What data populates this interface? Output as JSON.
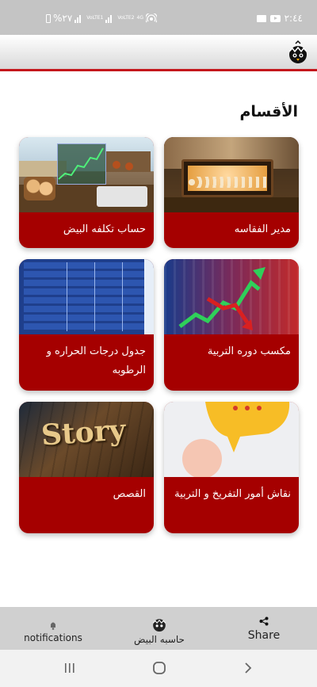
{
  "status": {
    "time": "٢:٤٤",
    "battery": "%٢٧",
    "net1": "VoLTE1",
    "net2": "VoLTE2",
    "net3": "4G"
  },
  "section_title": "الأقسام",
  "cards": [
    {
      "label": "مدير الفقاسه"
    },
    {
      "label": "حساب تكلفه البيض"
    },
    {
      "label": "مكسب دوره التربية"
    },
    {
      "label": "جدول درجات الحراره و الرطوبه"
    },
    {
      "label": "نقاش أمور التفريخ و التربية"
    },
    {
      "label": "القصص"
    }
  ],
  "story_image_text": "Story",
  "bottom_nav": {
    "notifications": "notifications",
    "calculator": "حاسبه البيض",
    "share": "Share"
  },
  "colors": {
    "card_bg": "#a50000",
    "header_line": "#c4171c",
    "status_bar": "#c4c4c4"
  }
}
